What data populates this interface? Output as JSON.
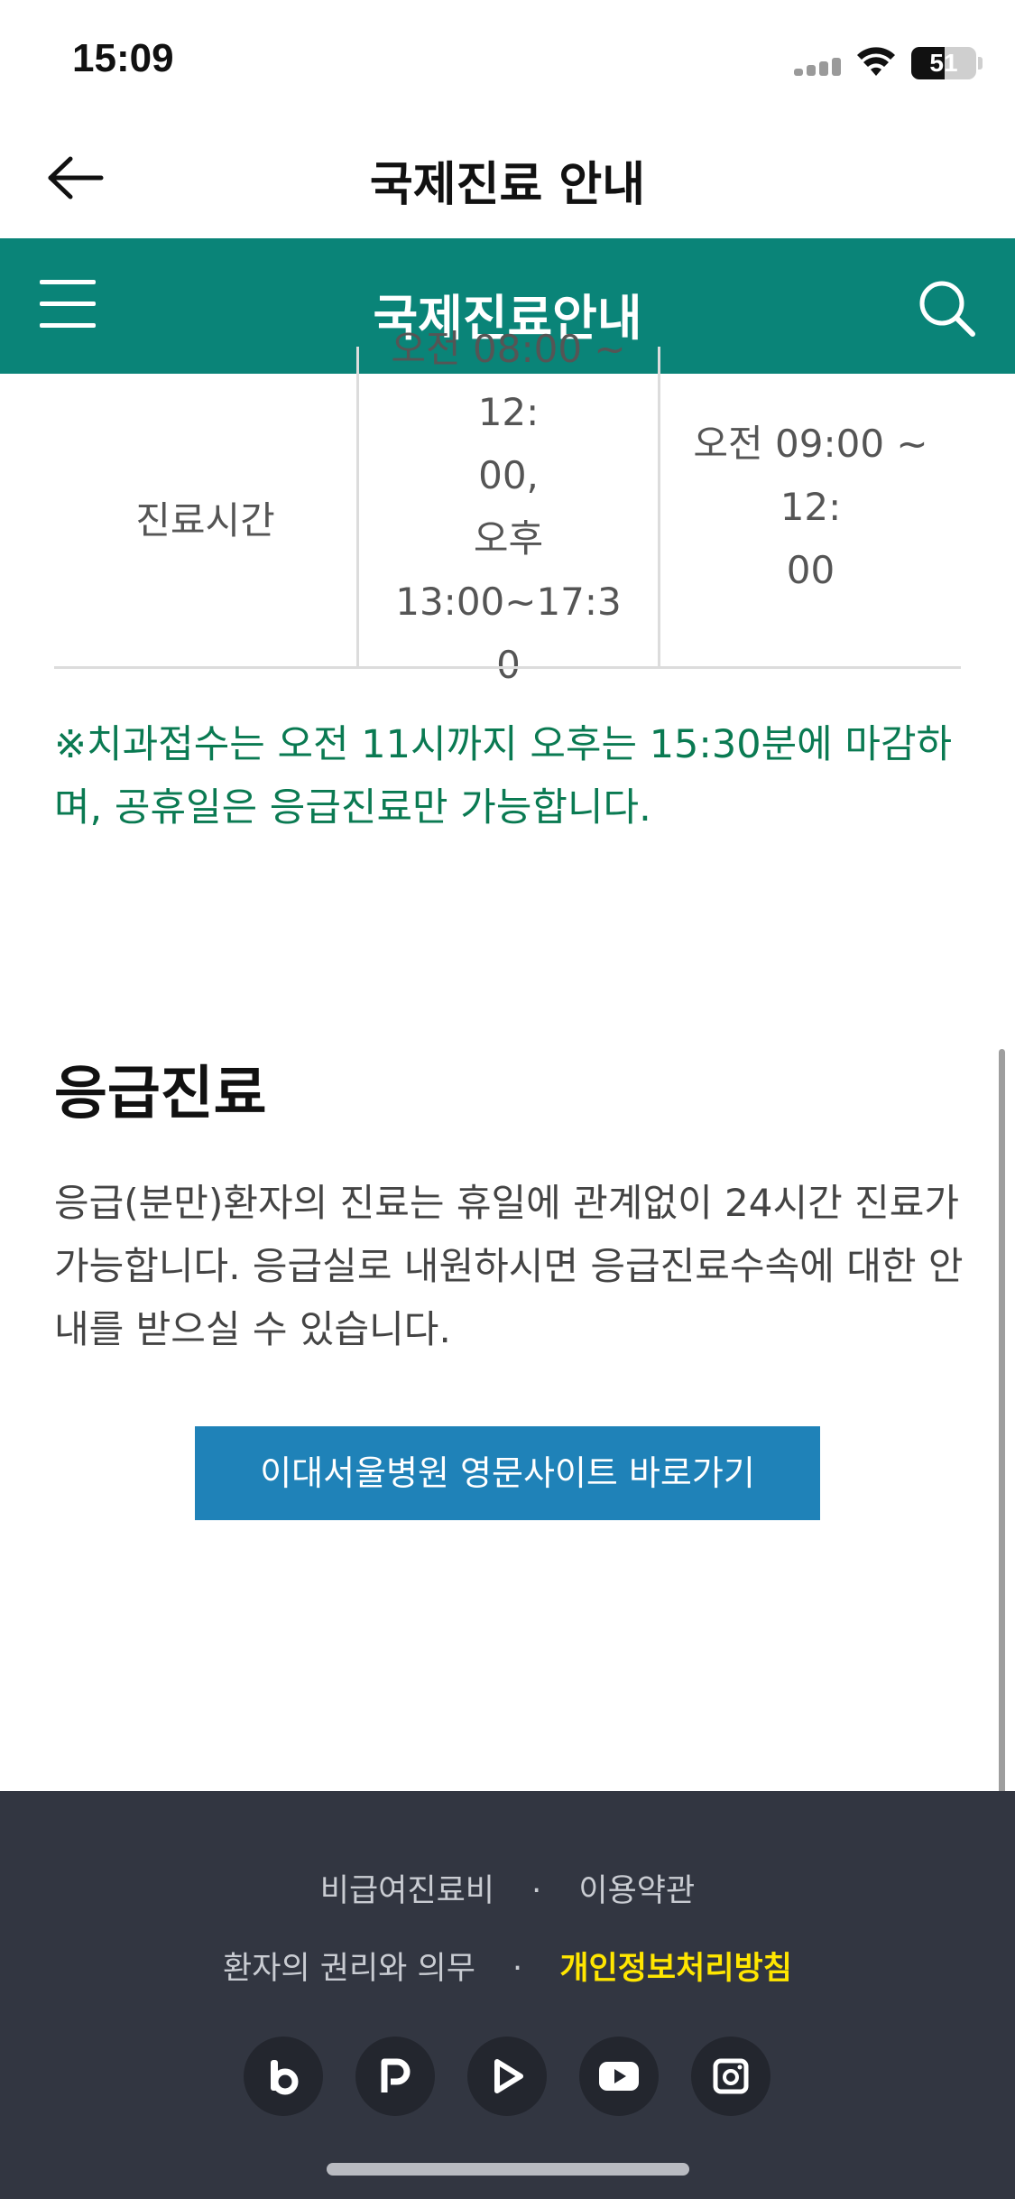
{
  "status_bar": {
    "time": "15:09",
    "battery": "51"
  },
  "title_bar": {
    "title": "국제진료 안내"
  },
  "site_header": {
    "title": "국제진료안내"
  },
  "hours_table": {
    "row_label": "진료시간",
    "col2": "오전 08:00 ~ 12:\n00,\n오후 13:00~17:3\n0",
    "col3": "오전 09:00 ~ 12:\n00"
  },
  "notice": "※치과접수는 오전 11시까지 오후는 15:30분에 마감하며, 공휴일은 응급진료만 가능합니다.",
  "emergency": {
    "heading": "응급진료",
    "body": "응급(분만)환자의 진료는 휴일에 관계없이 24시간 진료가 가능합니다. 응급실로 내원하시면 응급진료수속에 대한 안내를 받으실 수 있습니다."
  },
  "english_site_button": "이대서울병원 영문사이트 바로가기",
  "footer": {
    "links_row1": [
      "비급여진료비",
      "이용약관"
    ],
    "links_row2": [
      "환자의 권리와 의무",
      "개인정보처리방침"
    ],
    "highlight_color": "#ffe600",
    "social_icons": [
      "blog-icon",
      "post-icon",
      "play-icon",
      "youtube-icon",
      "instagram-icon"
    ]
  },
  "colors": {
    "header_green": "#0a8478",
    "notice_green": "#0a7a52",
    "button_blue": "#1f82b8",
    "footer_bg": "#323641"
  }
}
